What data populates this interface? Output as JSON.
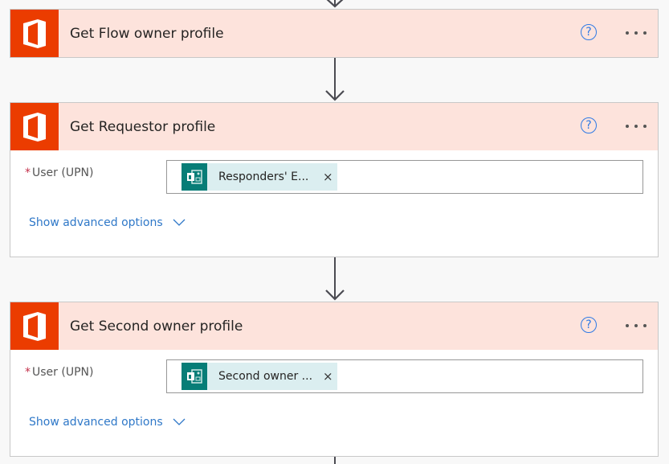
{
  "cards": [
    {
      "title": "Get Flow owner profile",
      "icon": "office-icon",
      "collapsed": true
    },
    {
      "title": "Get Requestor profile",
      "icon": "office-icon",
      "field": {
        "label": "User (UPN)",
        "required_marker": "*",
        "token": {
          "icon": "forms-icon",
          "text": "Responders' E...",
          "remove": "×"
        }
      },
      "advanced_label": "Show advanced options"
    },
    {
      "title": "Get Second owner profile",
      "icon": "office-icon",
      "field": {
        "label": "User (UPN)",
        "required_marker": "*",
        "token": {
          "icon": "forms-icon",
          "text": "Second owner ...",
          "remove": "×"
        }
      },
      "advanced_label": "Show advanced options"
    }
  ],
  "help_glyph": "?",
  "colors": {
    "office_orange": "#eb3c00",
    "header_bg": "#fde3dc",
    "forms_teal": "#077d77",
    "token_bg": "#dbeef0",
    "link_blue": "#2f78c8"
  }
}
